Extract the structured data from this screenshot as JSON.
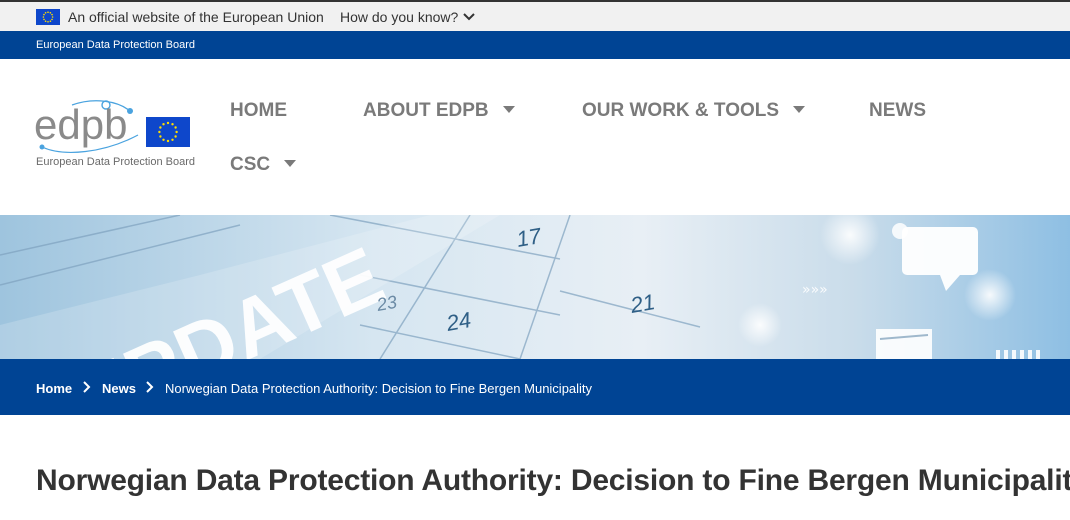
{
  "eu_bar": {
    "official_text": "An official website of the European Union",
    "how_know_label": "How do you know?"
  },
  "institution_bar": {
    "label": "European Data Protection Board"
  },
  "logo": {
    "wordmark": "edpb",
    "subtitle": "European Data Protection Board"
  },
  "nav": {
    "items": [
      {
        "label": "HOME",
        "dropdown": false
      },
      {
        "label": "ABOUT EDPB",
        "dropdown": true
      },
      {
        "label": "OUR WORK & TOOLS",
        "dropdown": true
      },
      {
        "label": "NEWS",
        "dropdown": false
      },
      {
        "label": "CSC",
        "dropdown": true
      }
    ]
  },
  "banner": {
    "word": "UPDATE",
    "calendar_days": [
      "17",
      "23",
      "24",
      "21"
    ]
  },
  "breadcrumb": {
    "items": [
      {
        "label": "Home"
      },
      {
        "label": "News"
      },
      {
        "label": "Norwegian Data Protection Authority: Decision to Fine Bergen Municipality"
      }
    ]
  },
  "page": {
    "title": "Norwegian Data Protection Authority: Decision to Fine Bergen Municipality"
  },
  "colors": {
    "eu_blue": "#004494",
    "flag_blue": "#0e47cb",
    "flag_star": "#ffde00",
    "nav_gray": "#7a7a7a"
  }
}
